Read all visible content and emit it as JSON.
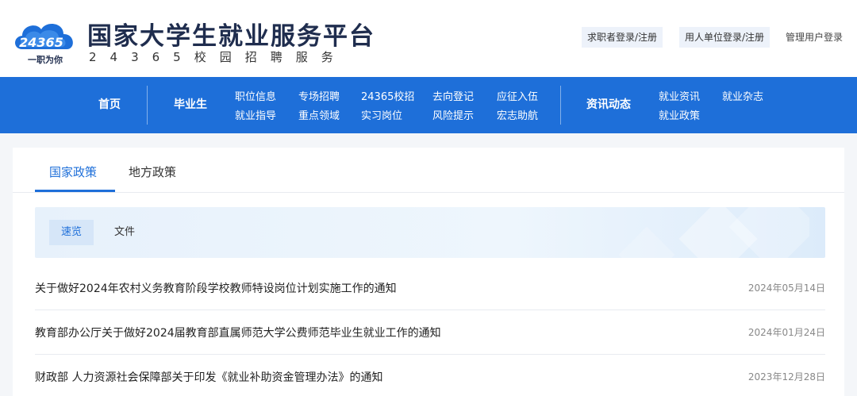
{
  "header": {
    "logo_number": "24365",
    "logo_tagline": "一职为你",
    "title": "国家大学生就业服务平台",
    "subtitle": "24365校园招聘服务",
    "jobseeker_login": "求职者登录/注册",
    "employer_login": "用人单位登录/注册",
    "admin_login": "管理用户登录"
  },
  "nav": {
    "home": "首页",
    "graduates": "毕业生",
    "col1": [
      "职位信息",
      "就业指导"
    ],
    "col2": [
      "专场招聘",
      "重点领域"
    ],
    "col3": [
      "24365校招",
      "实习岗位"
    ],
    "col4": [
      "去向登记",
      "风险提示"
    ],
    "col5": [
      "应征入伍",
      "宏志助航"
    ],
    "news": "资讯动态",
    "col6": [
      "就业资讯",
      "就业政策"
    ],
    "col7": [
      "就业杂志"
    ]
  },
  "tabs": [
    "国家政策",
    "地方政策"
  ],
  "filters": [
    "速览",
    "文件"
  ],
  "articles": [
    {
      "title": "关于做好2024年农村义务教育阶段学校教师特设岗位计划实施工作的通知",
      "date": "2024年05月14日"
    },
    {
      "title": "教育部办公厅关于做好2024届教育部直属师范大学公费师范毕业生就业工作的通知",
      "date": "2024年01月24日"
    },
    {
      "title": "财政部 人力资源社会保障部关于印发《就业补助资金管理办法》的通知",
      "date": "2023年12月28日"
    }
  ],
  "colors": {
    "brand_blue": "#1e6fd9",
    "title_navy": "#1f2d4e"
  }
}
